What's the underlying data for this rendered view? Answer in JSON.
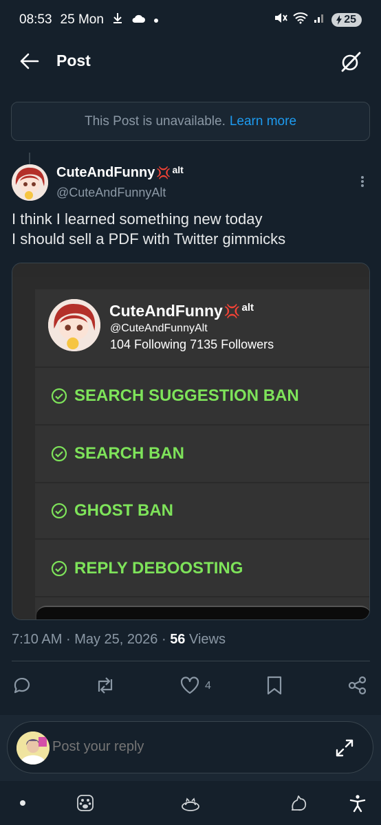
{
  "status_bar": {
    "time": "08:53",
    "date": "25 Mon",
    "battery": "25",
    "icons": [
      "download-icon",
      "cloud-icon",
      "dot-icon",
      "mute-icon",
      "wifi-icon",
      "signal-icon",
      "battery-icon"
    ]
  },
  "header": {
    "title": "Post",
    "back_icon": "arrow-left-icon",
    "grok_icon": "grok-icon"
  },
  "unavailable_notice": {
    "text": "This Post is unavailable.",
    "link": "Learn more"
  },
  "post": {
    "display_name": "CuteAndFunny",
    "name_emoji": "💢",
    "name_suffix": "alt",
    "handle": "@CuteAndFunnyAlt",
    "text_line1": "I think I learned something new today",
    "text_line2": "I should sell a PDF with Twitter gimmicks",
    "timestamp": "7:10 AM",
    "separator1": "·",
    "date": "May 25, 2026",
    "separator2": "·",
    "views_count": "56",
    "views_label": "Views",
    "likes_count": "4"
  },
  "embedded_image": {
    "display_name": "CuteAndFunny",
    "name_emoji": "💢",
    "name_suffix": "alt",
    "handle": "@CuteAndFunnyAlt",
    "stats": "104 Following 7135 Followers",
    "items": [
      "SEARCH SUGGESTION BAN",
      "SEARCH BAN",
      "GHOST BAN",
      "REPLY DEBOOSTING"
    ],
    "check_color": "#7ee35a"
  },
  "composer": {
    "placeholder": "Post your reply"
  },
  "colors": {
    "background": "#15202b",
    "accent": "#1d9bf0",
    "muted": "#8b98a5",
    "border": "#38444d"
  }
}
